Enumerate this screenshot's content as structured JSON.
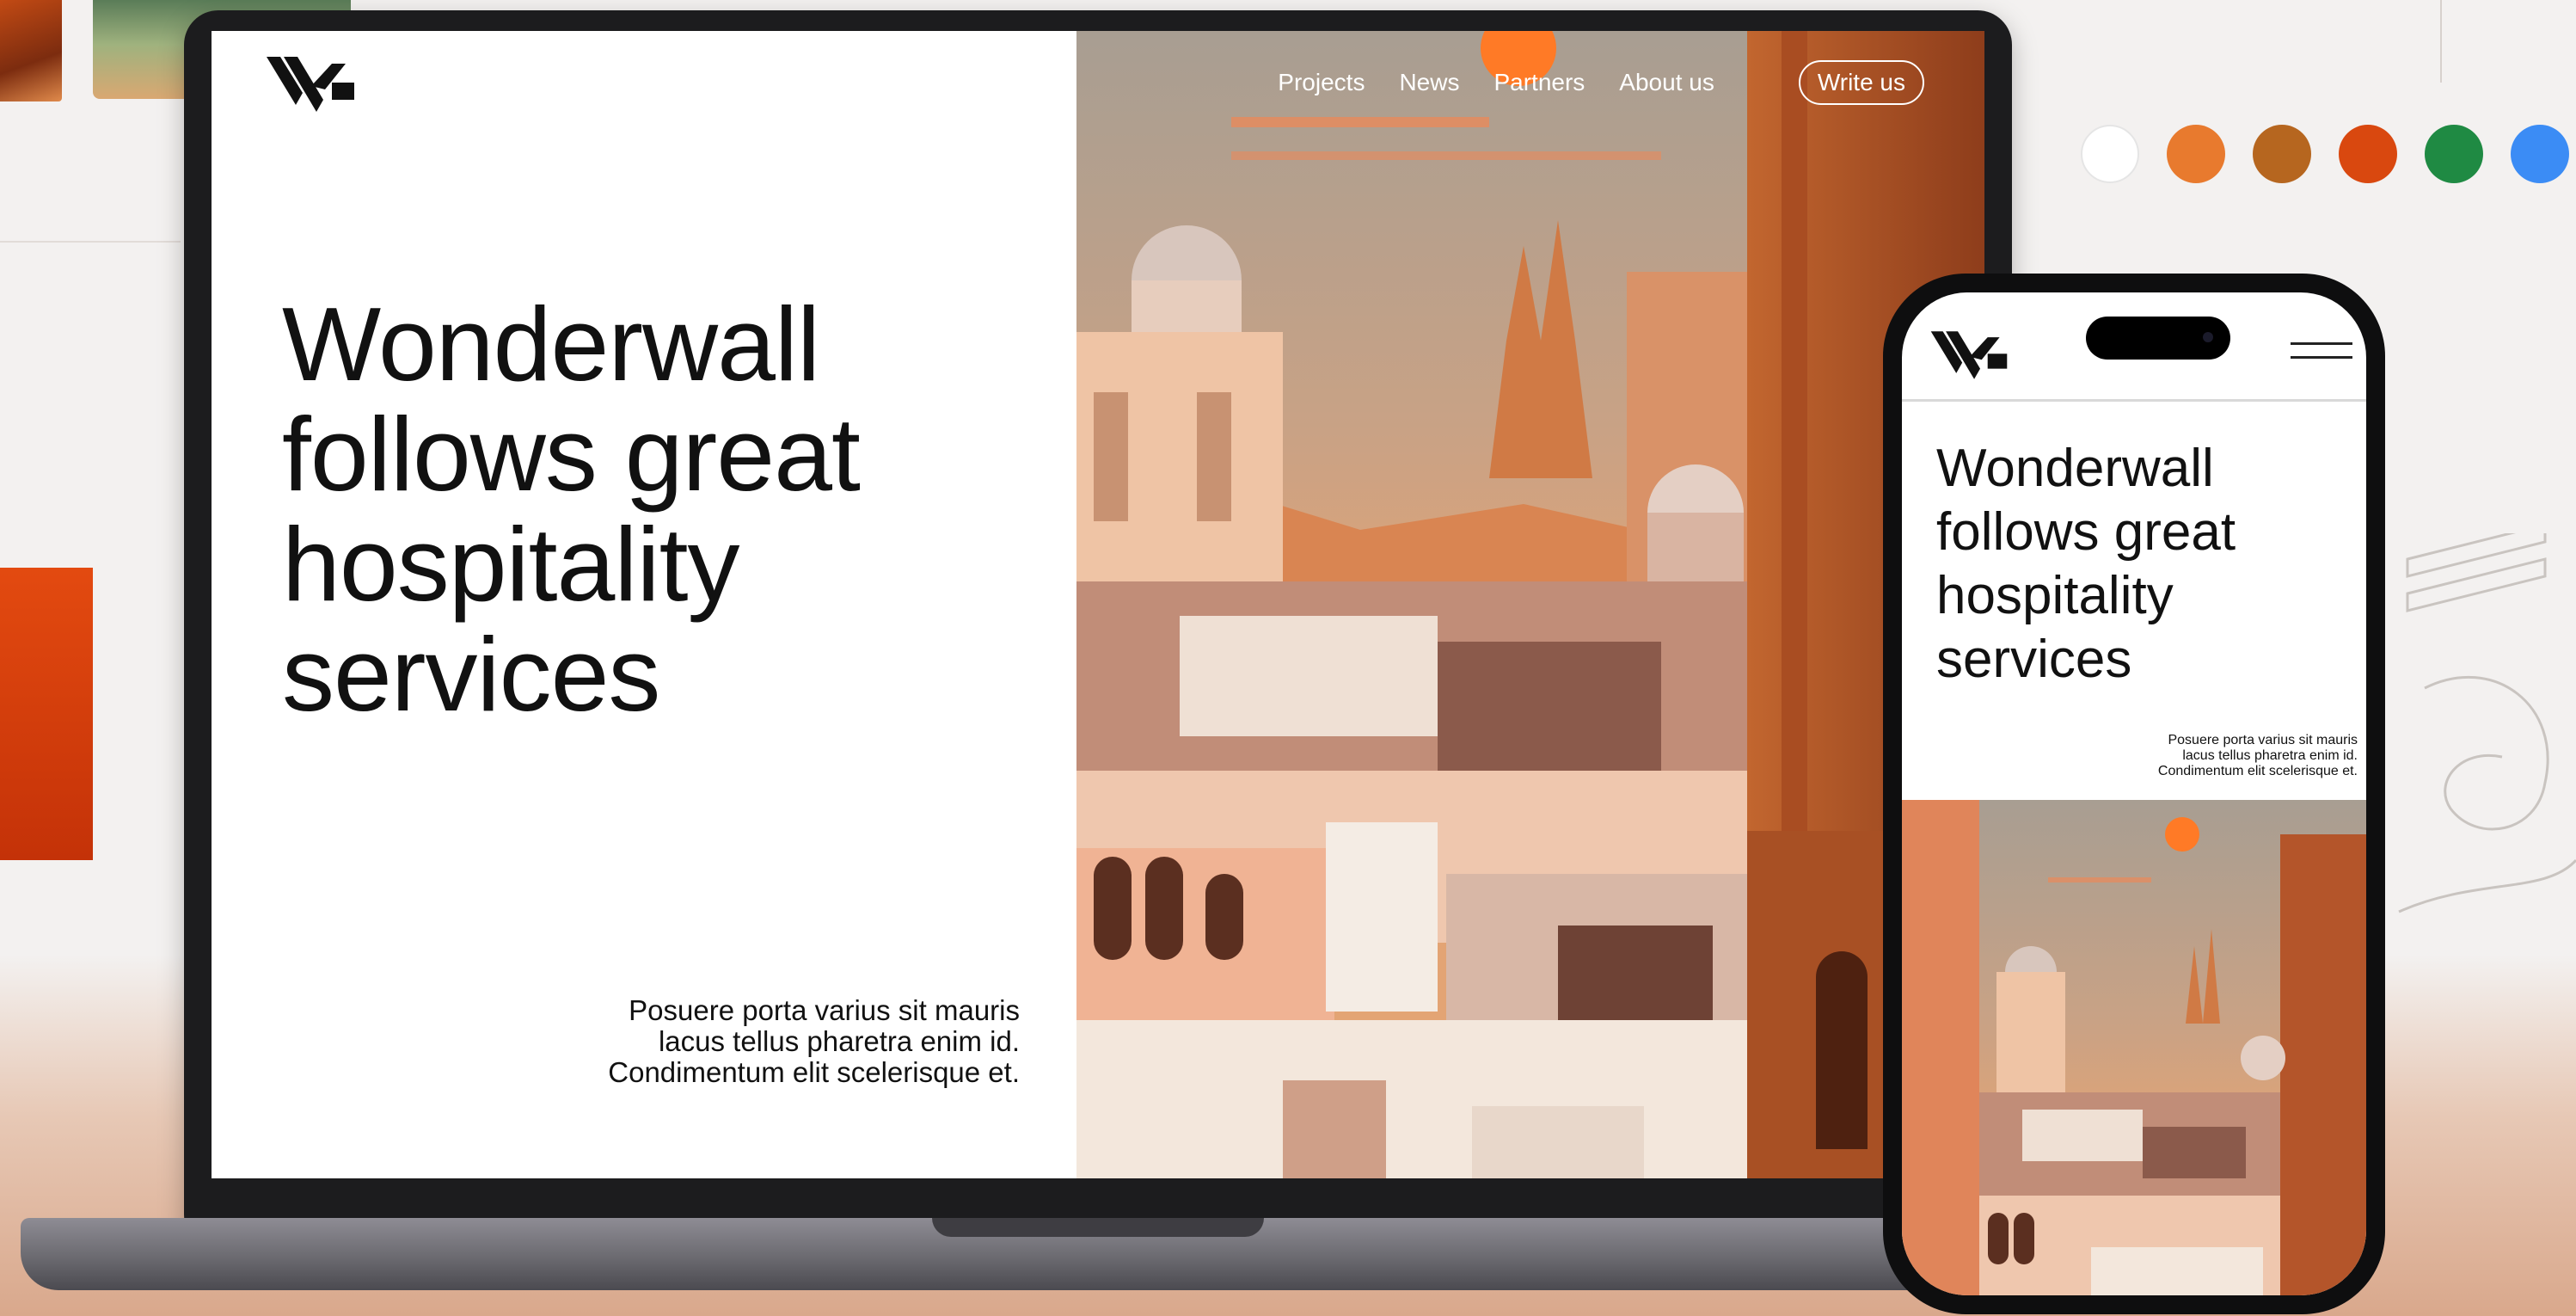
{
  "brand": {
    "logo_icon": "wonderwall-logo-icon"
  },
  "nav": {
    "links": [
      "Projects",
      "News",
      "Partners",
      "About us"
    ],
    "cta": "Write us"
  },
  "hero": {
    "title": "Wonderwall follows great hospitality services",
    "subtitle_lines": [
      "Posuere porta varius sit mauris",
      "lacus tellus pharetra enim id.",
      "Condimentum elit scelerisque et."
    ]
  },
  "mobile": {
    "title": "Wonderwall follows great hospitality services",
    "subtitle_lines": [
      "Posuere porta varius sit mauris",
      "lacus tellus pharetra enim id.",
      "Condimentum elit scelerisque et."
    ],
    "menu_icon": "hamburger-icon"
  },
  "palette": {
    "swatches": [
      "#ffffff",
      "#e87a2e",
      "#b6661f",
      "#d9480f",
      "#1f8a43",
      "#3b8cf5"
    ]
  },
  "colors": {
    "sky": "#c9a285",
    "sun": "#ff7a26",
    "building_light": "#f3d9c6",
    "building_mid": "#d9916a",
    "building_dark": "#8b4a2e",
    "tower_rust": "#b4552a"
  }
}
